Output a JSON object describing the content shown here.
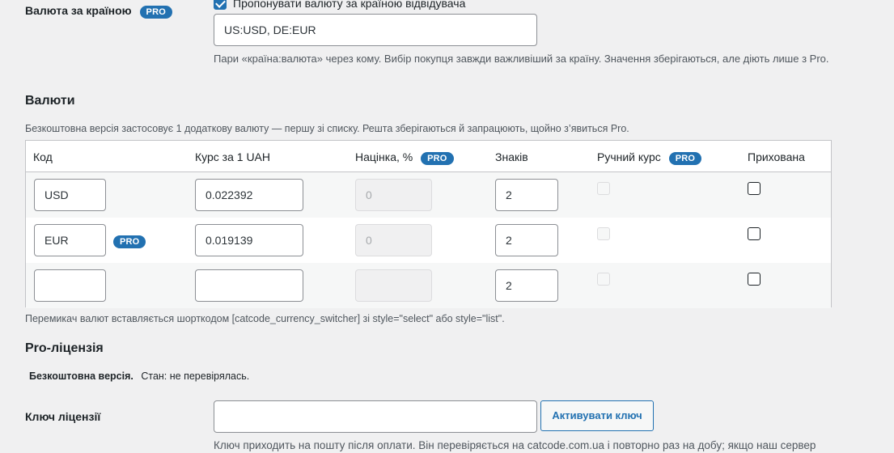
{
  "country_currency": {
    "label": "Валюта за країною",
    "pro_badge": "PRO",
    "checkbox_label": "Пропонувати валюту за країною відвідувача",
    "checked": true,
    "value": "US:USD, DE:EUR",
    "description": "Пари «країна:валюта» через кому. Вибір покупця завжди важливіший за країну. Значення зберігаються, але діють лише з Pro."
  },
  "currencies": {
    "heading": "Валюти",
    "note": "Безкоштовна версія застосовує 1 додаткову валюту — першу зі списку. Решта зберігаються й запрацюють, щойно з’явиться Pro.",
    "columns": {
      "code": "Код",
      "rate": "Курс за 1 UAH",
      "markup": "Націнка, %",
      "decimals": "Знаків",
      "manual_rate": "Ручний курс",
      "hidden": "Прихована",
      "pro_badge": "PRO"
    },
    "rows": [
      {
        "code": "USD",
        "rate": "0.022392",
        "markup": "0",
        "decimals": "2",
        "pro": ""
      },
      {
        "code": "EUR",
        "rate": "0.019139",
        "markup": "0",
        "decimals": "2",
        "pro": "PRO"
      },
      {
        "code": "",
        "rate": "",
        "markup": "",
        "decimals": "2",
        "pro": ""
      }
    ],
    "footnote": "Перемикач валют вставляється шорткодом [catcode_currency_switcher] зі style=\"select\" або style=\"list\"."
  },
  "license": {
    "heading": "Pro-ліцензія",
    "status_strong": "Безкоштовна версія.",
    "status_text": "Стан: не перевірялась.",
    "key_label": "Ключ ліцензії",
    "key_value": "",
    "activate_button": "Активувати ключ",
    "description": "Ключ приходить на пошту після оплати. Він перевіряється на catcode.com.ua і повторно раз на добу; якщо наш сервер"
  },
  "colors": {
    "accent": "#2271b1",
    "background": "#f0f0f1",
    "border": "#c3c4c7"
  }
}
